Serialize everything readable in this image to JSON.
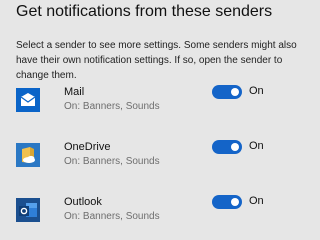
{
  "section": {
    "title": "Get notifications from these senders",
    "description": "Select a sender to see more settings. Some senders might also have their own notification settings. If so, open the sender to change them."
  },
  "senders": [
    {
      "name": "Mail",
      "status": "On: Banners, Sounds",
      "toggle_label": "On",
      "toggle_on": true,
      "icon": "mail-icon"
    },
    {
      "name": "OneDrive",
      "status": "On: Banners, Sounds",
      "toggle_label": "On",
      "toggle_on": true,
      "icon": "onedrive-icon"
    },
    {
      "name": "Outlook",
      "status": "On: Banners, Sounds",
      "toggle_label": "On",
      "toggle_on": true,
      "icon": "outlook-icon"
    }
  ],
  "colors": {
    "background": "#e6e6e6",
    "toggle_on": "#1464c8",
    "secondary_text": "#6e6e6e"
  }
}
